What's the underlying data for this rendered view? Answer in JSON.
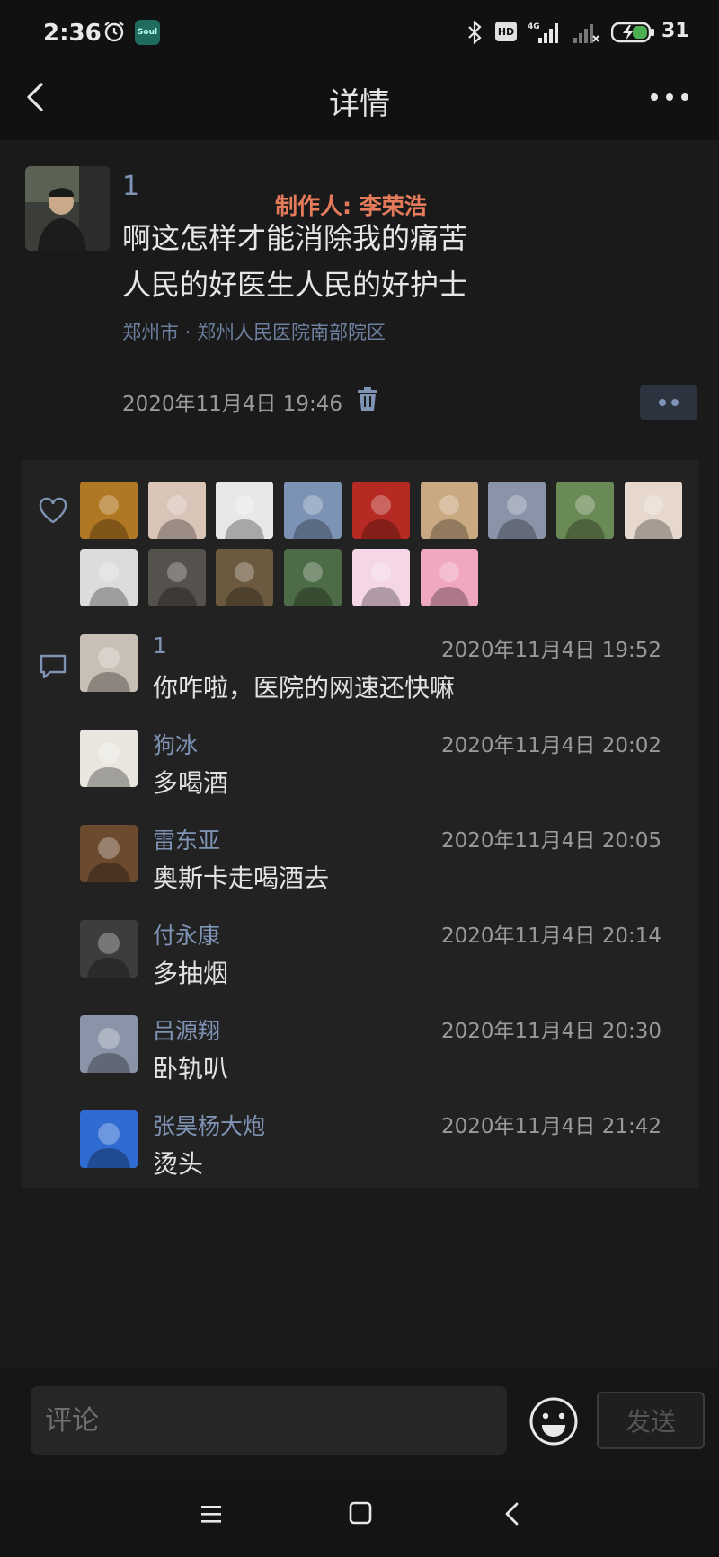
{
  "status_bar": {
    "time": "2:36",
    "soul_label": "Soul",
    "hd_label": "HD",
    "battery": "31"
  },
  "header": {
    "title": "详情"
  },
  "post": {
    "author": "1",
    "watermark": "制作人: 李荣浩",
    "line1": "啊这怎样才能消除我的痛苦",
    "line2": "人民的好医生人民的好护士",
    "location": "郑州市 · 郑州人民医院南部院区",
    "time": "2020年11月4日 19:46"
  },
  "likes": [
    {
      "color": "#b07822"
    },
    {
      "color": "#d9c4b8"
    },
    {
      "color": "#e8e8e8"
    },
    {
      "color": "#7c93b5"
    },
    {
      "color": "#b72a23"
    },
    {
      "color": "#c9a982"
    },
    {
      "color": "#8a94a8"
    },
    {
      "color": "#6a8a55"
    },
    {
      "color": "#e6d8cc"
    },
    {
      "color": "#dcdcdc"
    },
    {
      "color": "#55514c"
    },
    {
      "color": "#6b5a3f"
    },
    {
      "color": "#4d6b46"
    },
    {
      "color": "#f4d6e6"
    },
    {
      "color": "#f0a8c0"
    }
  ],
  "comments": [
    {
      "name": "1",
      "time": "2020年11月4日 19:52",
      "text": "你咋啦，医院的网速还快嘛",
      "color": "#c8bfb5"
    },
    {
      "name": "狗冰",
      "time": "2020年11月4日 20:02",
      "text": "多喝酒",
      "color": "#e9e5df"
    },
    {
      "name": "雷东亚",
      "time": "2020年11月4日 20:05",
      "text": "奥斯卡走喝酒去",
      "color": "#6b4a2e"
    },
    {
      "name": "付永康",
      "time": "2020年11月4日 20:14",
      "text": "多抽烟",
      "color": "#3d3d3d"
    },
    {
      "name": "吕源翔",
      "time": "2020年11月4日 20:30",
      "text": "卧轨叭",
      "color": "#8a94a8"
    },
    {
      "name": "张昊杨大炮",
      "time": "2020年11月4日 21:42",
      "text": "烫头",
      "color": "#2f6bd0"
    }
  ],
  "input": {
    "placeholder": "评论",
    "send_label": "发送"
  }
}
